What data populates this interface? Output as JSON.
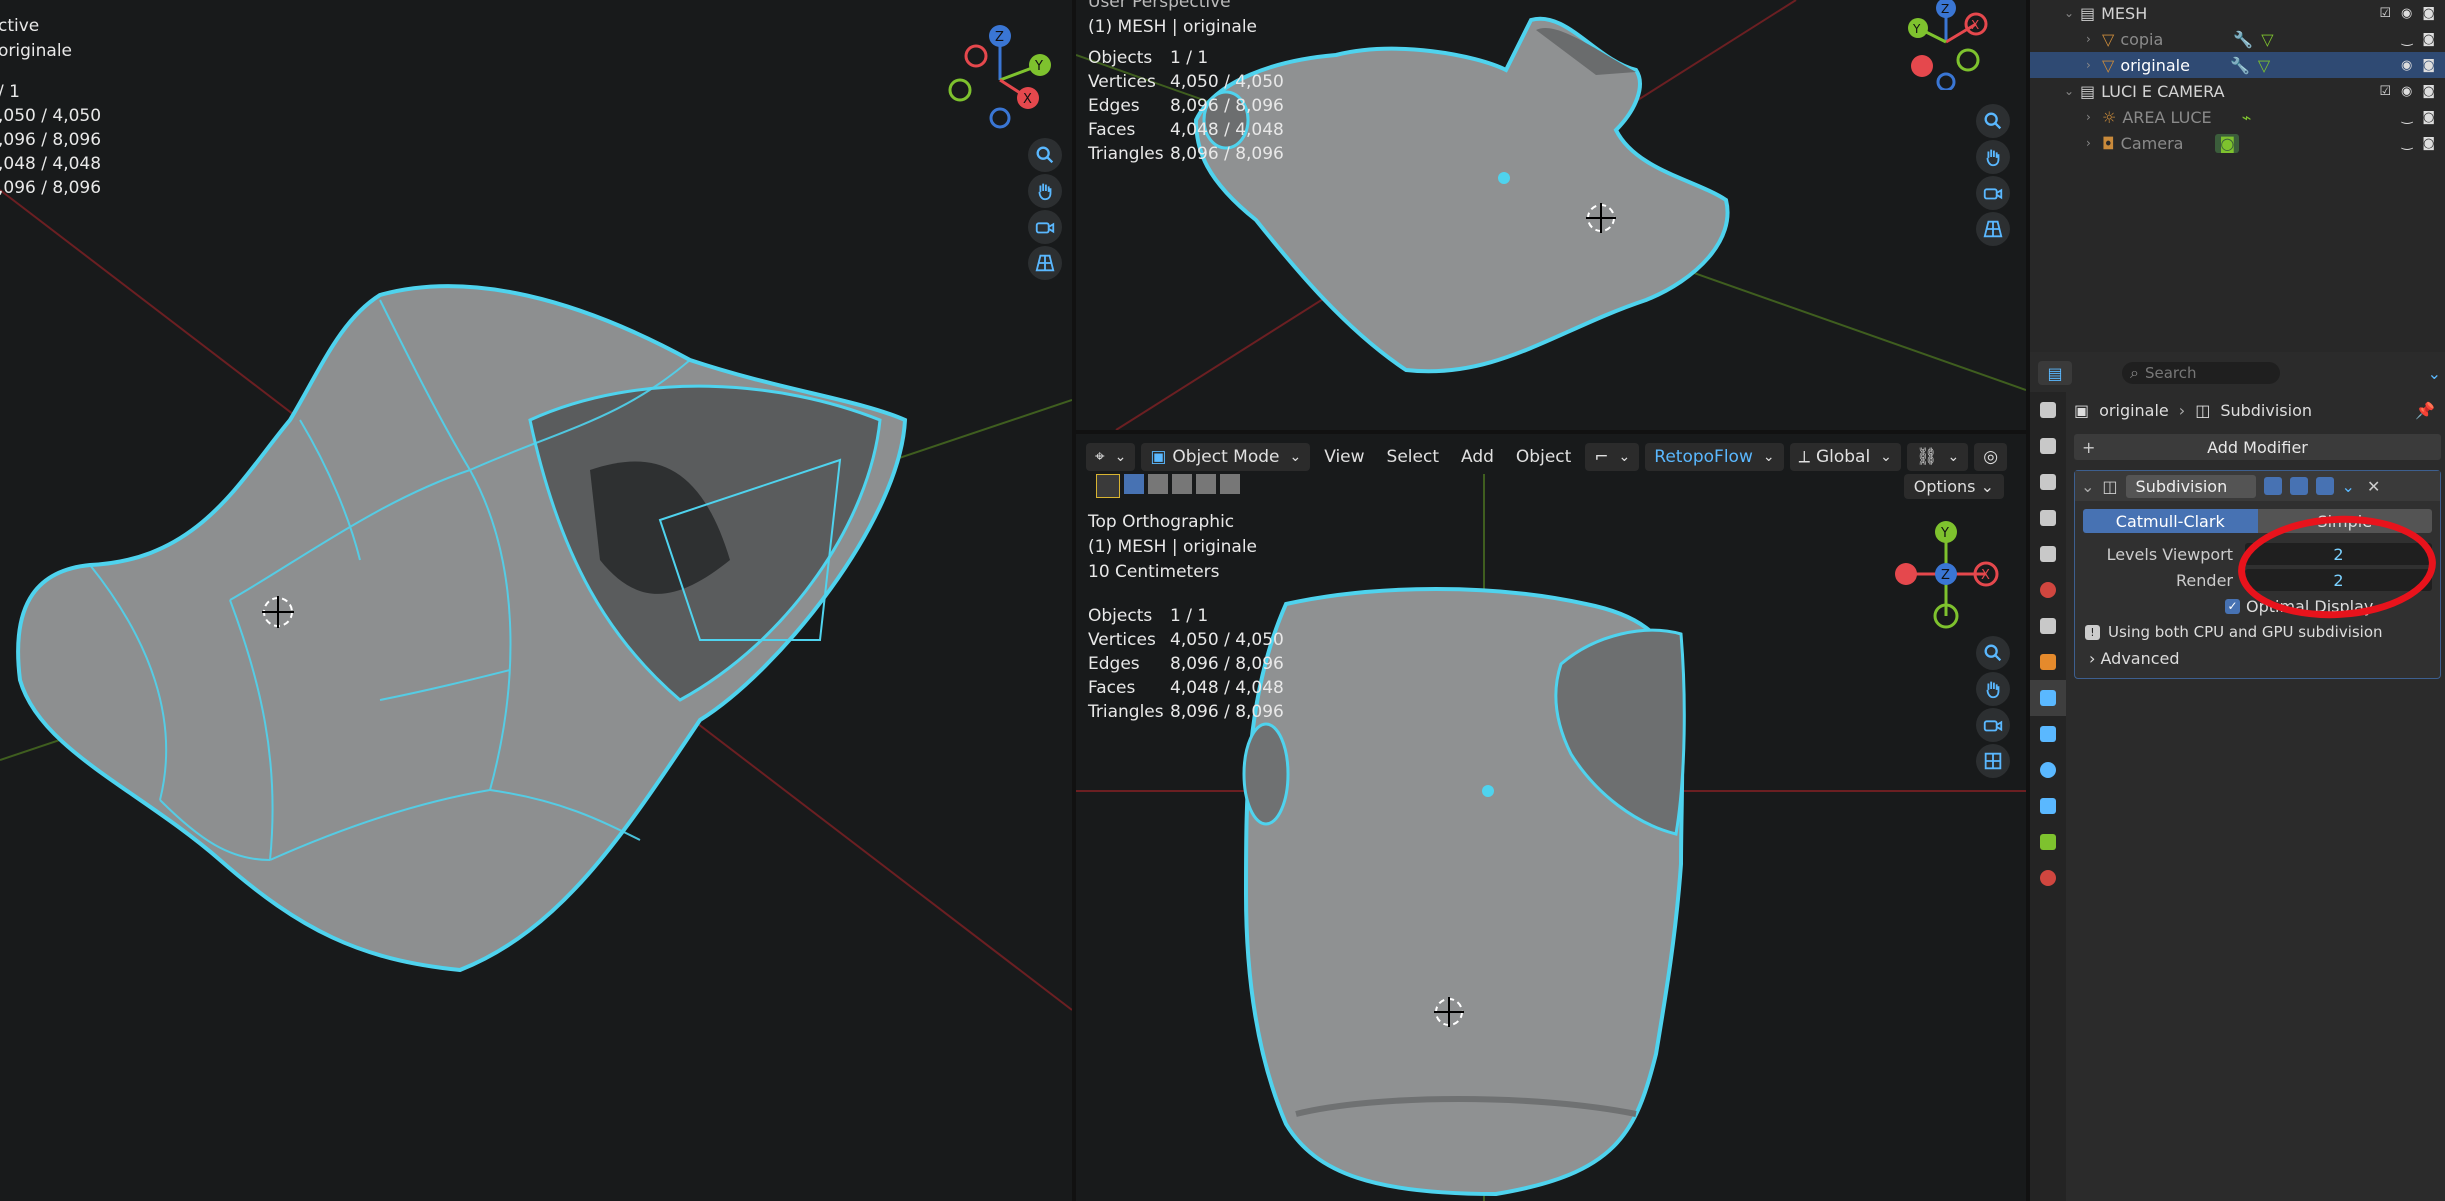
{
  "left_viewport": {
    "mode_line1": "ctive",
    "mode_line2": "originale",
    "stats": [
      "/ 1",
      ",050 / 4,050",
      ",096 / 8,096",
      ",048 / 4,048",
      ",096 / 8,096"
    ]
  },
  "top_viewport": {
    "title_cut": "User Perspective",
    "object_line": "(1) MESH | originale",
    "stats": {
      "objects": {
        "label": "Objects",
        "value": "1 / 1"
      },
      "vertices": {
        "label": "Vertices",
        "value": "4,050 / 4,050"
      },
      "edges": {
        "label": "Edges",
        "value": "8,096 / 8,096"
      },
      "faces": {
        "label": "Faces",
        "value": "4,048 / 4,048"
      },
      "triangles": {
        "label": "Triangles",
        "value": "8,096 / 8,096"
      }
    }
  },
  "bottom_viewport": {
    "header": {
      "mode": "Object Mode",
      "view": "View",
      "select": "Select",
      "add": "Add",
      "object": "Object",
      "retopo": "RetopoFlow",
      "orientation": "Global",
      "options": "Options"
    },
    "title": "Top Orthographic",
    "object_line": "(1) MESH | originale",
    "scale": "10 Centimeters",
    "stats": {
      "objects": {
        "label": "Objects",
        "value": "1 / 1"
      },
      "vertices": {
        "label": "Vertices",
        "value": "4,050 / 4,050"
      },
      "edges": {
        "label": "Edges",
        "value": "8,096 / 8,096"
      },
      "faces": {
        "label": "Faces",
        "value": "4,048 / 4,048"
      },
      "triangles": {
        "label": "Triangles",
        "value": "8,096 / 8,096"
      }
    }
  },
  "gizmo_labels": {
    "x": "X",
    "y": "Y",
    "z": "Z"
  },
  "outliner": {
    "rows": [
      {
        "label": "MESH",
        "type": "collection"
      },
      {
        "label": "copia",
        "type": "object"
      },
      {
        "label": "originale",
        "type": "object",
        "selected": true
      },
      {
        "label": "LUCI E CAMERA",
        "type": "collection"
      },
      {
        "label": "AREA LUCE",
        "type": "light"
      },
      {
        "label": "Camera",
        "type": "camera"
      }
    ]
  },
  "properties": {
    "search_placeholder": "Search",
    "breadcrumb_object": "originale",
    "breadcrumb_modifier": "Subdivision",
    "add_modifier": "Add Modifier",
    "modifier": {
      "name": "Subdivision",
      "type_catmull": "Catmull-Clark",
      "type_simple": "Simple",
      "levels_viewport_label": "Levels Viewport",
      "levels_viewport_value": "2",
      "render_label": "Render",
      "render_value": "2",
      "optimal_display": "Optimal Display",
      "info": "Using both CPU and GPU subdivision",
      "advanced": "Advanced"
    }
  },
  "colors": {
    "accent": "#4772b3",
    "outline": "#4fd3ee",
    "annotation": "#e8131c",
    "axis_x": "#e5484d",
    "axis_y": "#7ec22e",
    "axis_z": "#3a76d4"
  }
}
